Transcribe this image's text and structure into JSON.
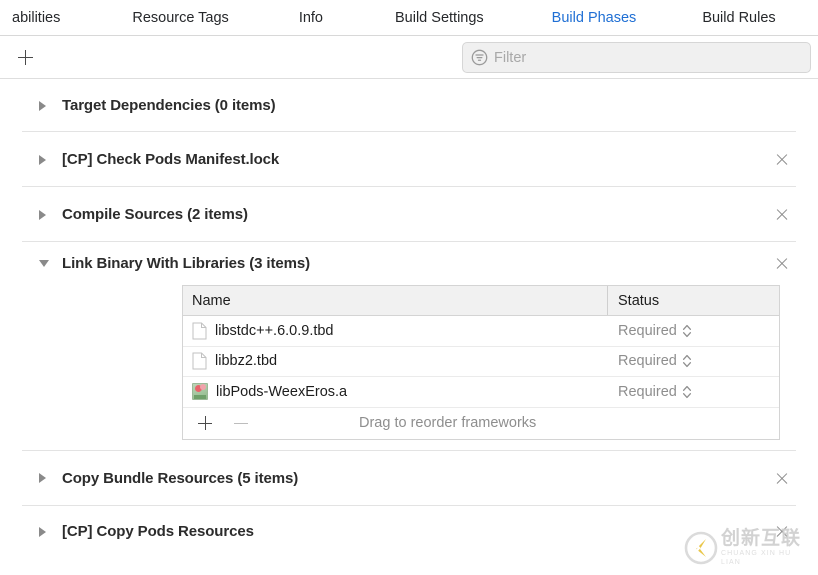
{
  "tabs": [
    {
      "label": "abilities",
      "active": false
    },
    {
      "label": "Resource Tags",
      "active": false
    },
    {
      "label": "Info",
      "active": false
    },
    {
      "label": "Build Settings",
      "active": false
    },
    {
      "label": "Build Phases",
      "active": true
    },
    {
      "label": "Build Rules",
      "active": false
    }
  ],
  "toolbar": {
    "add_label": "+",
    "filter_placeholder": "Filter",
    "filter_value": "",
    "filter_icon": "filter-circle-icon"
  },
  "phases": [
    {
      "title": "Target Dependencies (0 items)",
      "expanded": false,
      "removable": false
    },
    {
      "title": "[CP] Check Pods Manifest.lock",
      "expanded": false,
      "removable": true
    },
    {
      "title": "Compile Sources (2 items)",
      "expanded": false,
      "removable": true
    },
    {
      "title": "Link Binary With Libraries (3 items)",
      "expanded": true,
      "removable": true
    },
    {
      "title": "Copy Bundle Resources (5 items)",
      "expanded": false,
      "removable": true
    },
    {
      "title": "[CP] Copy Pods Resources",
      "expanded": false,
      "removable": true
    }
  ],
  "libraries_table": {
    "columns": [
      "Name",
      "Status"
    ],
    "rows": [
      {
        "name": "libstdc++.6.0.9.tbd",
        "status": "Required",
        "icon": "document-icon"
      },
      {
        "name": "libbz2.tbd",
        "status": "Required",
        "icon": "document-icon"
      },
      {
        "name": "libPods-WeexEros.a",
        "status": "Required",
        "icon": "static-library-icon"
      }
    ],
    "footer": {
      "add_label": "+",
      "remove_label": "−",
      "hint": "Drag to reorder frameworks"
    }
  },
  "watermark": {
    "chinese": "创新互联",
    "pinyin": "CHUANG XIN HU LIAN"
  },
  "colors": {
    "active_tab": "#1f6fd4",
    "text": "#2c2c2c",
    "muted": "#8e8e8e",
    "separator": "#e3e3e3",
    "header_bg": "#f1f1f1"
  }
}
